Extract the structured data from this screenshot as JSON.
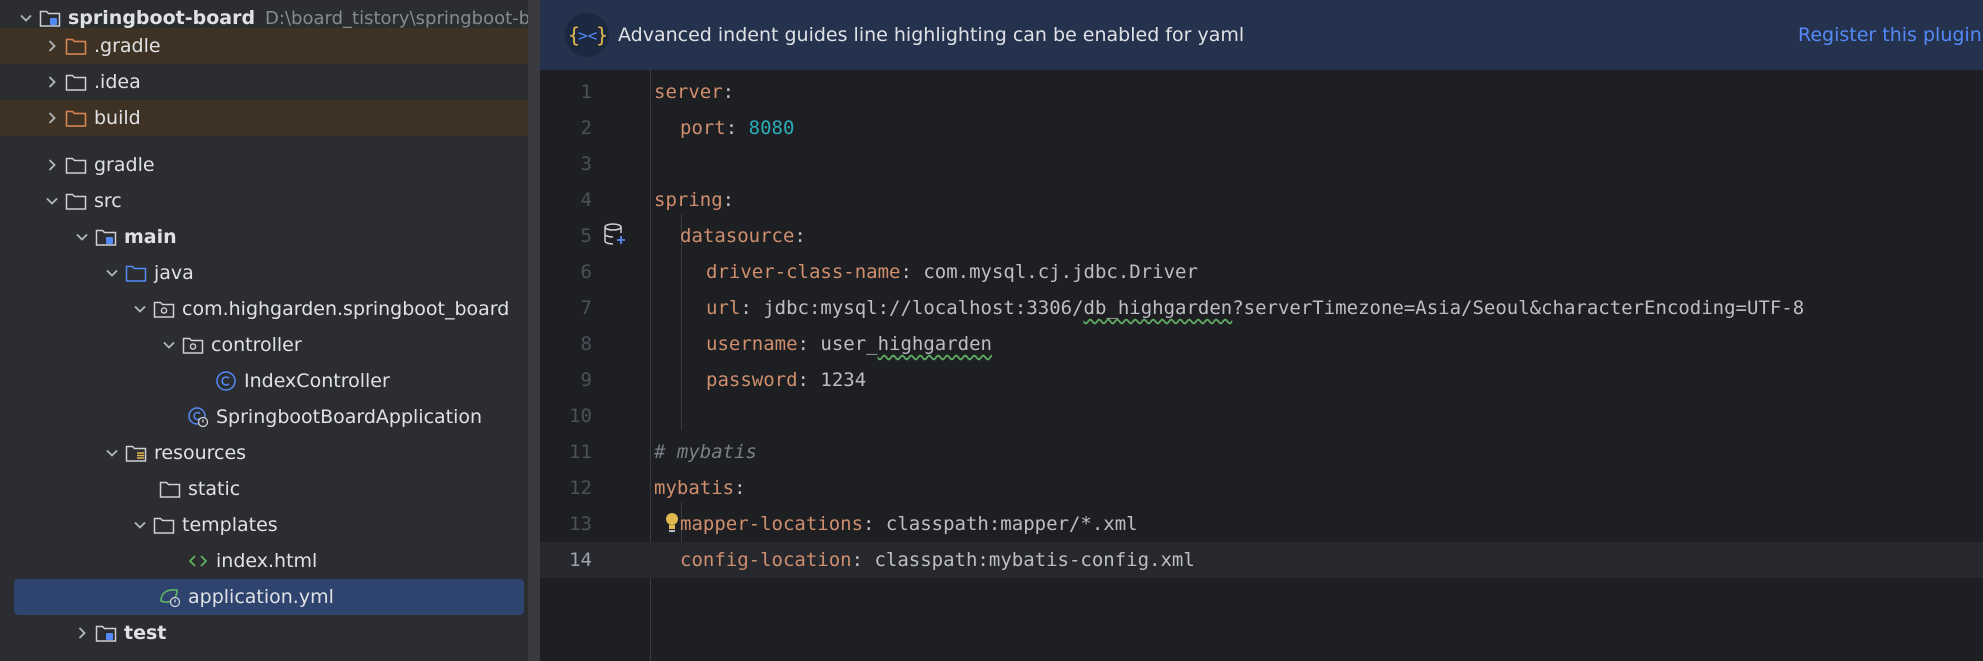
{
  "project": {
    "name": "springboot-board",
    "path": "D:\\board_tistory\\springboot-board"
  },
  "tree": [
    {
      "label": ".gradle",
      "kind": "folder-orange",
      "expanded": false
    },
    {
      "label": ".idea",
      "kind": "folder",
      "expanded": false
    },
    {
      "label": "build",
      "kind": "folder-orange",
      "expanded": false
    },
    {
      "label": "gradle",
      "kind": "folder",
      "expanded": false
    },
    {
      "label": "src",
      "kind": "folder",
      "expanded": true
    },
    {
      "label": "main",
      "kind": "module-folder",
      "expanded": true
    },
    {
      "label": "java",
      "kind": "source-folder",
      "expanded": true
    },
    {
      "label": "com.highgarden.springboot_board",
      "kind": "package",
      "expanded": true
    },
    {
      "label": "controller",
      "kind": "package",
      "expanded": true
    },
    {
      "label": "IndexController",
      "kind": "class"
    },
    {
      "label": "SpringbootBoardApplication",
      "kind": "spring-class"
    },
    {
      "label": "resources",
      "kind": "resources-folder",
      "expanded": true
    },
    {
      "label": "static",
      "kind": "folder"
    },
    {
      "label": "templates",
      "kind": "folder",
      "expanded": true
    },
    {
      "label": "index.html",
      "kind": "html"
    },
    {
      "label": "application.yml",
      "kind": "spring-yml",
      "selected": true
    },
    {
      "label": "test",
      "kind": "module-folder",
      "expanded": false
    }
  ],
  "banner": {
    "message": "Advanced indent guides line highlighting can be enabled for yaml",
    "action": "Register this plugin t"
  },
  "editor": {
    "current_line": 14,
    "lines": [
      {
        "n": "1",
        "key": "server",
        "sep": ":",
        "val": ""
      },
      {
        "n": "2",
        "key": "port",
        "sep": ": ",
        "val": "8080"
      },
      {
        "n": "3"
      },
      {
        "n": "4",
        "key": "spring",
        "sep": ":",
        "val": ""
      },
      {
        "n": "5",
        "key": "datasource",
        "sep": ":",
        "val": ""
      },
      {
        "n": "6",
        "key": "driver-class-name",
        "sep": ": ",
        "val": "com.mysql.cj.jdbc.Driver"
      },
      {
        "n": "7",
        "key": "url",
        "sep": ": ",
        "val_a": "jdbc:mysql://localhost:3306/",
        "val_b": "db_highgarden",
        "val_c": "?serverTimezone=Asia/Seoul&characterEncoding=UTF-8"
      },
      {
        "n": "8",
        "key": "username",
        "sep": ": ",
        "val_a": "user_",
        "val_b": "highgarden"
      },
      {
        "n": "9",
        "key": "password",
        "sep": ": ",
        "val": "1234"
      },
      {
        "n": "10"
      },
      {
        "n": "11",
        "comment": "# mybatis"
      },
      {
        "n": "12",
        "key": "mybatis",
        "sep": ":",
        "val": ""
      },
      {
        "n": "13",
        "key": "mapper-locations",
        "sep": ": ",
        "val": "classpath:mapper/*.xml"
      },
      {
        "n": "14",
        "key": "config-location",
        "sep": ": ",
        "val": "classpath:mybatis-config.xml"
      }
    ]
  },
  "colors": {
    "tree_bg": "#2b2d30",
    "editor_bg": "#1e1f22",
    "selection": "#2e436e",
    "excluded_highlight": "#3d3223",
    "yaml_key": "#cf8e6d",
    "number": "#2aacb8",
    "banner_bg": "#25324d",
    "link": "#548af7"
  }
}
